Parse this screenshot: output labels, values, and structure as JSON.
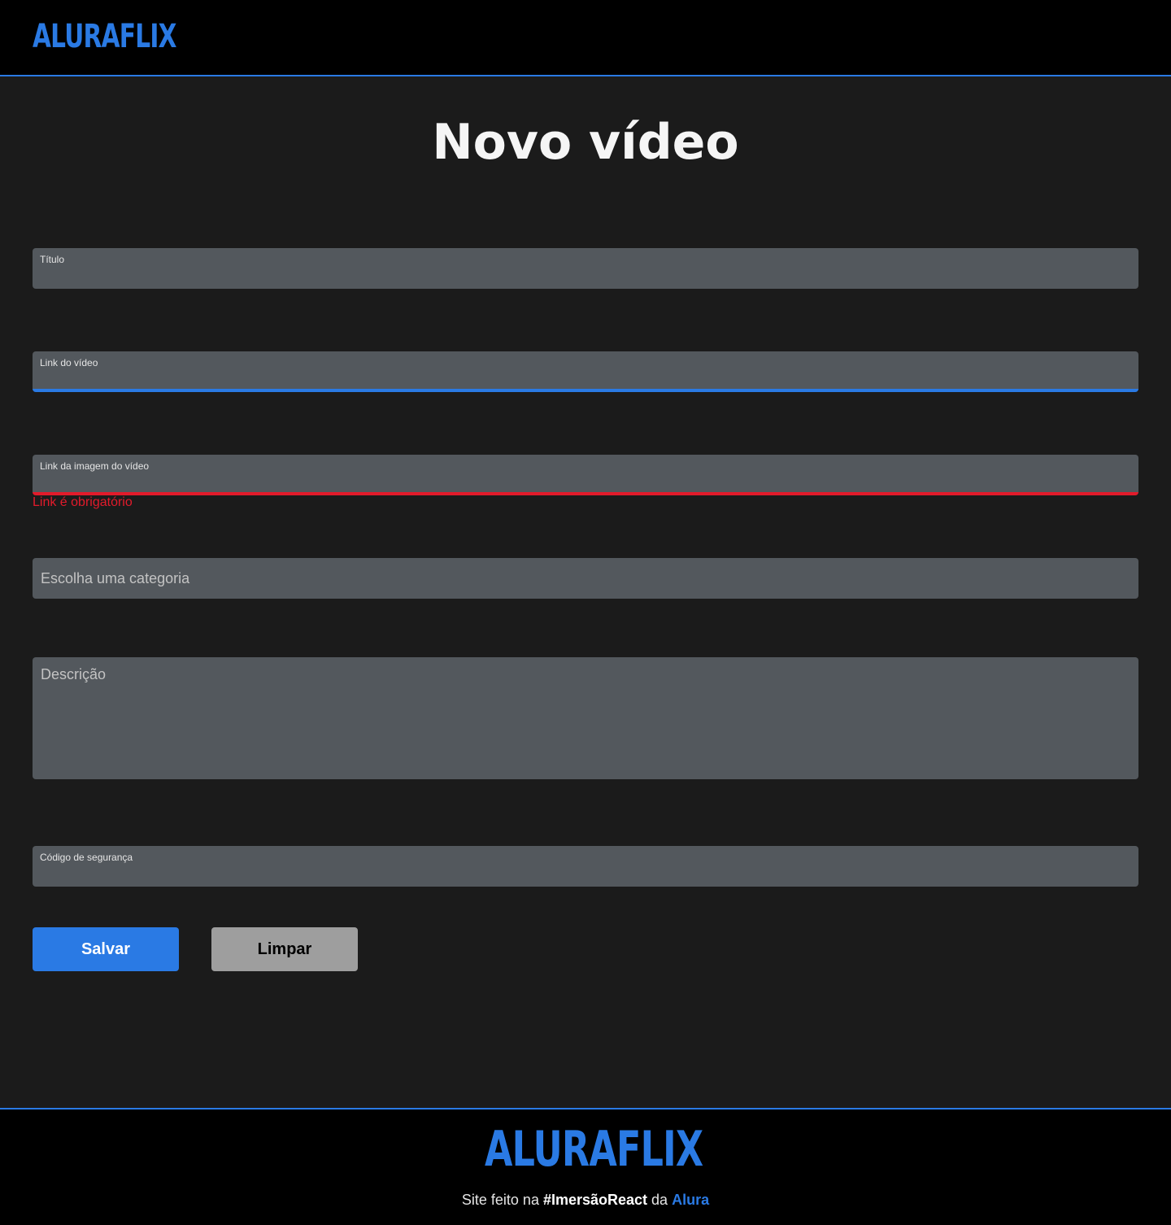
{
  "header": {
    "logo": "ALURAFLIX"
  },
  "page_title": "Novo vídeo",
  "form": {
    "titulo_label": "Título",
    "link_video_label": "Link do vídeo",
    "link_imagem_label": "Link da imagem do vídeo",
    "link_imagem_error": "Link é obrigatório",
    "categoria_placeholder": "Escolha uma categoria",
    "descricao_placeholder": "Descrição",
    "codigo_label": "Código de segurança",
    "save_label": "Salvar",
    "clear_label": "Limpar"
  },
  "footer": {
    "logo": "ALURAFLIX",
    "text_prefix": "Site feito na ",
    "text_hashtag": "#ImersãoReact",
    "text_middle": " da ",
    "text_brand": "Alura"
  },
  "colors": {
    "accent": "#2a7ae4",
    "error": "#e21b2b",
    "field_bg": "#53585d",
    "page_bg": "#1b1b1b"
  }
}
